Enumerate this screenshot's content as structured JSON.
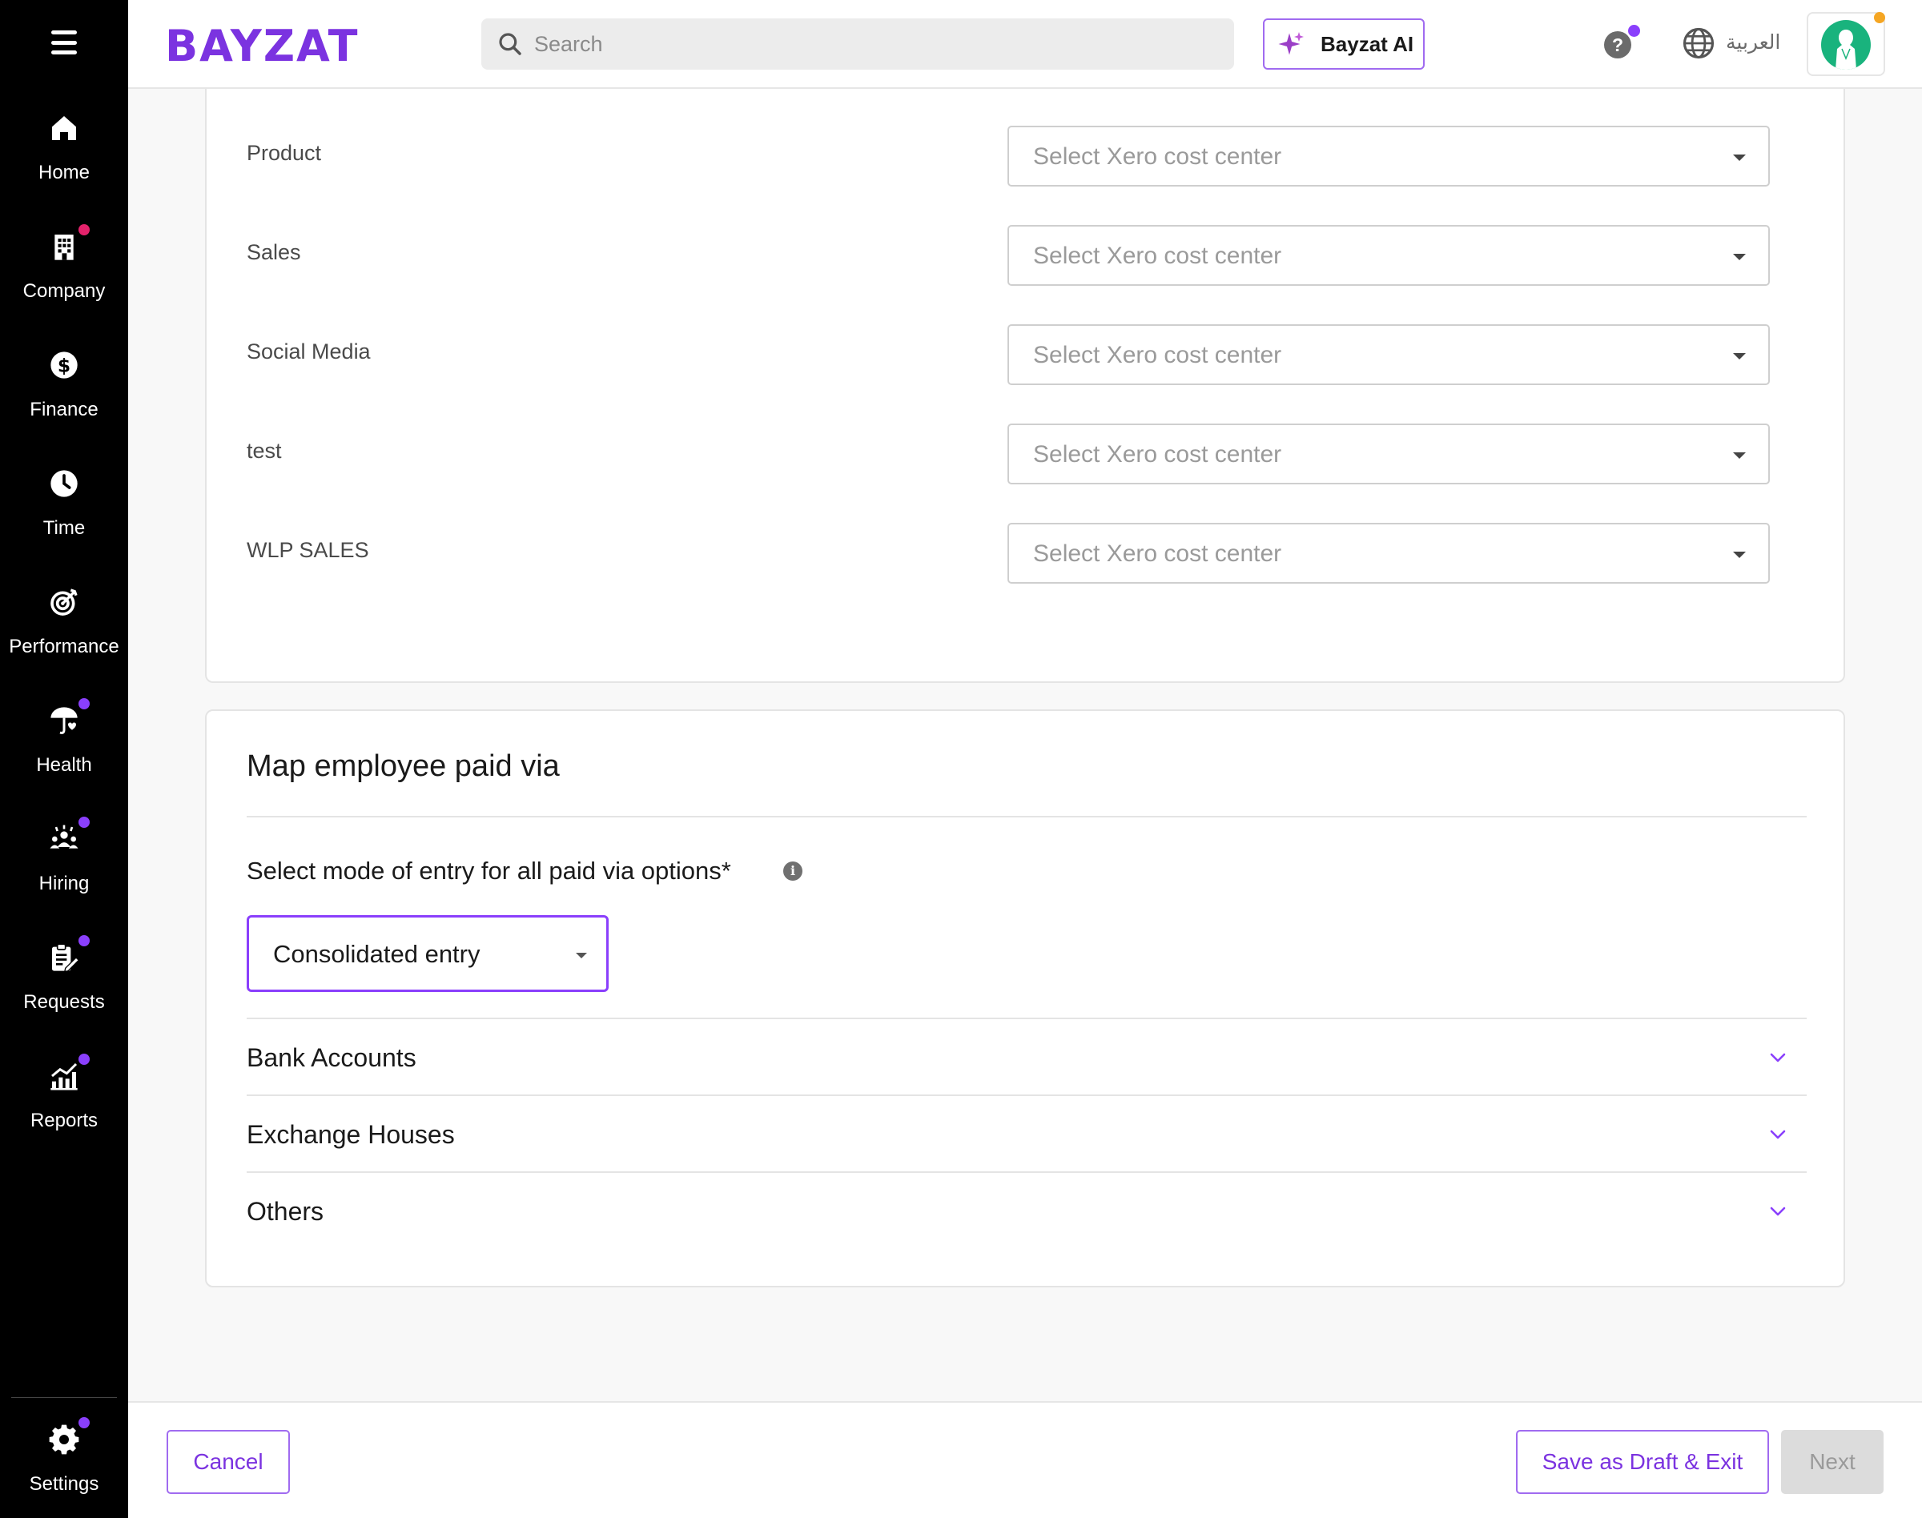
{
  "sidebar": {
    "items": [
      {
        "label": "Home",
        "icon": "home-icon"
      },
      {
        "label": "Company",
        "icon": "building-icon"
      },
      {
        "label": "Finance",
        "icon": "dollar-icon"
      },
      {
        "label": "Time",
        "icon": "clock-icon"
      },
      {
        "label": "Performance",
        "icon": "target-icon"
      },
      {
        "label": "Health",
        "icon": "umbrella-heart-icon"
      },
      {
        "label": "Hiring",
        "icon": "people-icon"
      },
      {
        "label": "Requests",
        "icon": "clipboard-edit-icon"
      },
      {
        "label": "Reports",
        "icon": "chart-icon"
      }
    ],
    "settings": {
      "label": "Settings",
      "icon": "gear-icon"
    }
  },
  "header": {
    "logo": "BAYZAT",
    "search_placeholder": "Search",
    "ai_button": "Bayzat AI",
    "help": "?",
    "language": "العربية"
  },
  "mapping": {
    "rows": [
      {
        "label": "Product",
        "placeholder": "Select Xero cost center"
      },
      {
        "label": "Sales",
        "placeholder": "Select Xero cost center"
      },
      {
        "label": "Social Media",
        "placeholder": "Select Xero cost center"
      },
      {
        "label": "test",
        "placeholder": "Select Xero cost center"
      },
      {
        "label": "WLP SALES",
        "placeholder": "Select Xero cost center"
      }
    ]
  },
  "paid_via": {
    "title": "Map employee paid via",
    "mode_label": "Select mode of entry for all paid via options*",
    "info": "i",
    "mode_value": "Consolidated entry",
    "sections": [
      {
        "label": "Bank Accounts"
      },
      {
        "label": "Exchange Houses"
      },
      {
        "label": "Others"
      }
    ]
  },
  "footer": {
    "cancel": "Cancel",
    "save_draft": "Save as Draft & Exit",
    "next": "Next"
  },
  "colors": {
    "brand": "#7b33e0",
    "accent_border": "#a06bf0",
    "notification_dot": "#8a3ffc",
    "alert_dot": "#e4226b",
    "sidebar_bg": "#000000"
  }
}
